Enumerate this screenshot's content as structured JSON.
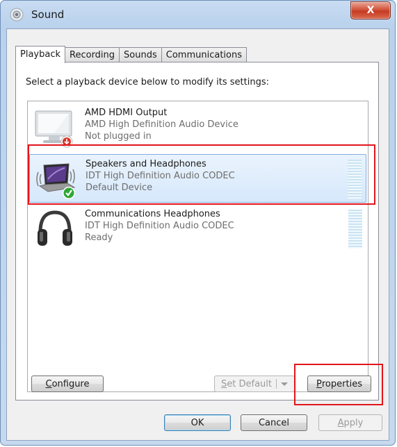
{
  "window": {
    "title": "Sound",
    "close_glyph": "X"
  },
  "tabs": [
    {
      "label": "Playback",
      "active": true
    },
    {
      "label": "Recording",
      "active": false
    },
    {
      "label": "Sounds",
      "active": false
    },
    {
      "label": "Communications",
      "active": false
    }
  ],
  "panel": {
    "instructions": "Select a playback device below to modify its settings:"
  },
  "devices": [
    {
      "name": "AMD HDMI Output",
      "driver": "AMD High Definition Audio Device",
      "status": "Not plugged in",
      "icon": "monitor-icon",
      "badge": "unplugged-badge-icon",
      "selected": false
    },
    {
      "name": "Speakers and Headphones",
      "driver": "IDT High Definition Audio CODEC",
      "status": "Default Device",
      "icon": "laptop-speakers-icon",
      "badge": "default-check-icon",
      "selected": true
    },
    {
      "name": "Communications Headphones",
      "driver": "IDT High Definition Audio CODEC",
      "status": "Ready",
      "icon": "headphones-icon",
      "badge": null,
      "selected": false
    }
  ],
  "buttons": {
    "configure": {
      "first": "C",
      "rest": "onfigure"
    },
    "set_default": {
      "first": "S",
      "rest": "et Default"
    },
    "properties": {
      "first": "P",
      "rest": "roperties"
    },
    "ok": "OK",
    "cancel": "Cancel",
    "apply": {
      "first": "A",
      "rest": "pply"
    }
  },
  "colors": {
    "highlight_red": "#e3141b",
    "selection_blue": "#84acdd",
    "default_check_green": "#2fa836"
  }
}
